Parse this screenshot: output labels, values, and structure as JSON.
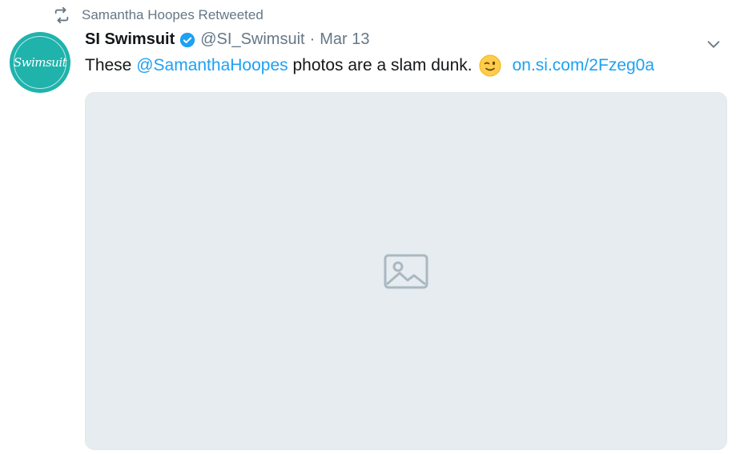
{
  "retweet": {
    "label": "Samantha Hoopes Retweeted",
    "icon": "retweet-icon"
  },
  "author": {
    "name": "SI Swimsuit",
    "handle": "@SI_Swimsuit",
    "separator": "·",
    "date": "Mar 13",
    "verified": true,
    "avatar_text": "Swimsuit"
  },
  "tweet": {
    "text_before": "These ",
    "mention": "@SamanthaHoopes",
    "text_after": " photos are a slam dunk.",
    "emoji": "winking-face-emoji",
    "link": "on.si.com/2Fzeg0a"
  },
  "media": {
    "type": "photo"
  },
  "colors": {
    "accent": "#1da1f2",
    "muted": "#657786",
    "avatar_bg": "#1fb3ac",
    "placeholder_bg": "#e6ecf0"
  }
}
